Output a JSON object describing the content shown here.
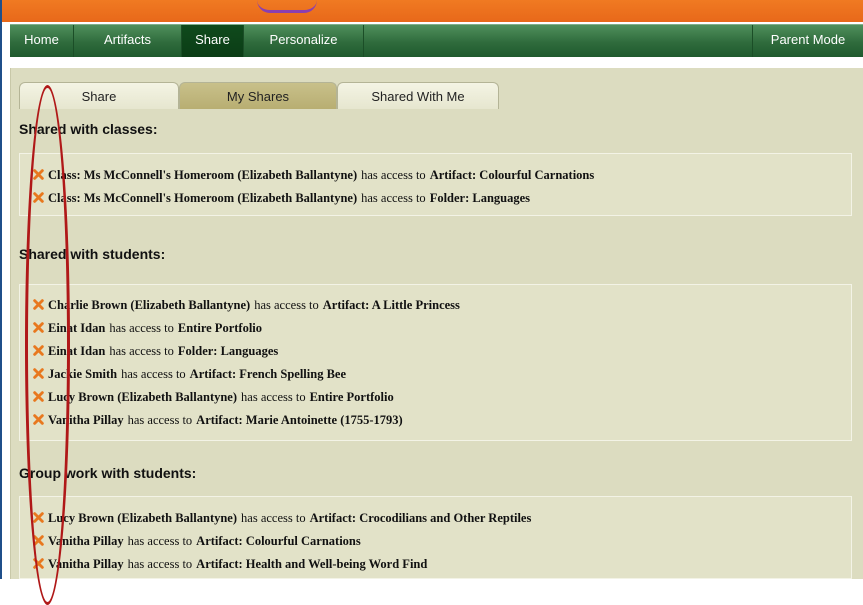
{
  "nav": {
    "items": [
      "Home",
      "Artifacts",
      "Share",
      "Personalize"
    ],
    "right_item": "Parent Mode"
  },
  "tabs": [
    "Share",
    "My Shares",
    "Shared With Me"
  ],
  "connector": "has access to",
  "sections": [
    {
      "title": "Shared with classes:",
      "rows": [
        {
          "who": "Class: Ms McConnell's Homeroom (Elizabeth Ballantyne)",
          "what": "Artifact: Colourful Carnations"
        },
        {
          "who": "Class: Ms McConnell's Homeroom (Elizabeth Ballantyne)",
          "what": "Folder: Languages"
        }
      ]
    },
    {
      "title": "Shared with students:",
      "rows": [
        {
          "who": "Charlie Brown (Elizabeth Ballantyne)",
          "what": "Artifact: A Little Princess"
        },
        {
          "who": "Einat Idan",
          "what": "Entire Portfolio"
        },
        {
          "who": "Einat Idan",
          "what": "Folder: Languages"
        },
        {
          "who": "Jackie Smith",
          "what": "Artifact: French Spelling Bee"
        },
        {
          "who": "Lucy Brown (Elizabeth Ballantyne)",
          "what": "Entire Portfolio"
        },
        {
          "who": "Vanitha Pillay",
          "what": "Artifact: Marie Antoinette (1755-1793)"
        }
      ]
    },
    {
      "title": "Group work with students:",
      "rows": [
        {
          "who": "Lucy Brown (Elizabeth Ballantyne)",
          "what": "Artifact: Crocodilians and Other Reptiles"
        },
        {
          "who": "Vanitha Pillay",
          "what": "Artifact: Colourful Carnations"
        },
        {
          "who": "Vanitha Pillay",
          "what": "Artifact: Health and Well-being Word Find"
        }
      ]
    }
  ],
  "colors": {
    "top_bar": "#e8681a",
    "nav_green": "#2f6b3c",
    "panel_bg": "#dcdcc0",
    "remove_icon": "#e8781e",
    "annotation": "#b01818"
  }
}
